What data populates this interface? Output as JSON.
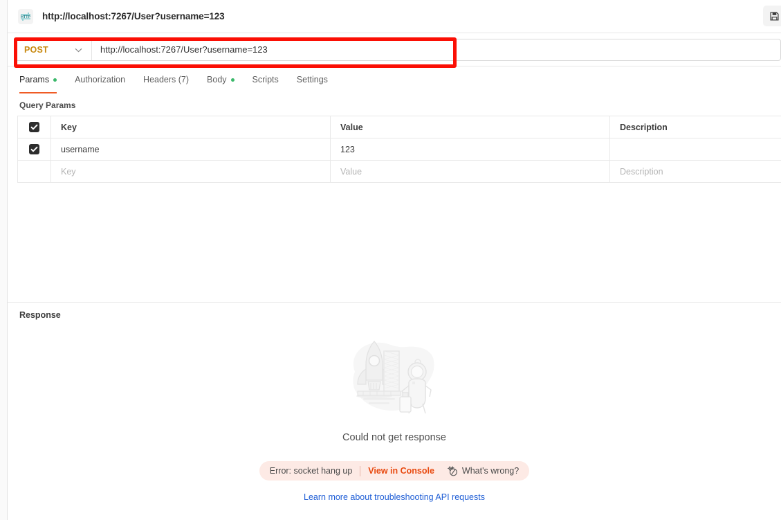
{
  "titlebar": {
    "protocol_badge": "HTTP",
    "request_title": "http://localhost:7267/User?username=123",
    "save_icon_name": "save-icon"
  },
  "urlbar": {
    "method": "POST",
    "method_color": "#c8890f",
    "url": "http://localhost:7267/User?username=123",
    "annotation_color": "#fb0f05"
  },
  "tabs": [
    {
      "label": "Params",
      "has_dot": true,
      "active": true
    },
    {
      "label": "Authorization",
      "has_dot": false,
      "active": false
    },
    {
      "label": "Headers (7)",
      "has_dot": false,
      "active": false
    },
    {
      "label": "Body",
      "has_dot": true,
      "active": false
    },
    {
      "label": "Scripts",
      "has_dot": false,
      "active": false
    },
    {
      "label": "Settings",
      "has_dot": false,
      "active": false
    }
  ],
  "params": {
    "section_title": "Query Params",
    "columns": {
      "key": "Key",
      "value": "Value",
      "description": "Description"
    },
    "rows": [
      {
        "checked": true,
        "key": "username",
        "value": "123",
        "description": ""
      }
    ],
    "placeholder_row": {
      "key": "Key",
      "value": "Value",
      "description": "Description"
    }
  },
  "response": {
    "label": "Response",
    "empty_message": "Could not get response",
    "error": {
      "text": "Error: socket hang up",
      "console_link": "View in Console",
      "whats_wrong": "What's wrong?",
      "pill_bg": "#fdeae5",
      "link_color": "#e8490f"
    },
    "learn_more": "Learn more about troubleshooting API requests",
    "learn_more_color": "#1f5ed6"
  },
  "theme": {
    "accent_orange": "#ef5b25",
    "dot_green": "#3ab86a",
    "border": "#e8e8e8"
  }
}
